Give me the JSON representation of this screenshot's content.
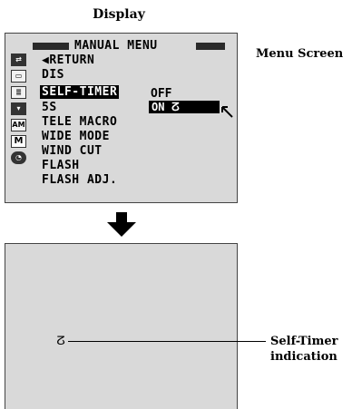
{
  "display_label": "Display",
  "menu_screen_label": "Menu Screen",
  "menu": {
    "title": "MANUAL MENU",
    "items": [
      {
        "label": "◀RETURN"
      },
      {
        "label": "DIS"
      },
      {
        "label": "SELF-TIMER"
      },
      {
        "label": "5S"
      },
      {
        "label": "TELE MACRO"
      },
      {
        "label": "WIDE MODE"
      },
      {
        "label": "WIND CUT"
      },
      {
        "label": "FLASH"
      },
      {
        "label": "FLASH ADJ."
      }
    ],
    "selected_item": "SELF-TIMER",
    "options": {
      "off": "OFF",
      "on": "ON"
    },
    "icons": [
      "camera-mode-icon",
      "record-mode-icon",
      "display-settings-icon",
      "system-icon",
      "auto-manual-icon",
      "manual-icon",
      "clock-icon"
    ],
    "icon_text": {
      "auto_manual": "AM",
      "manual": "M"
    }
  },
  "self_timer": {
    "symbol": "ⵒ",
    "label_line1": "Self-Timer",
    "label_line2": "indication"
  }
}
